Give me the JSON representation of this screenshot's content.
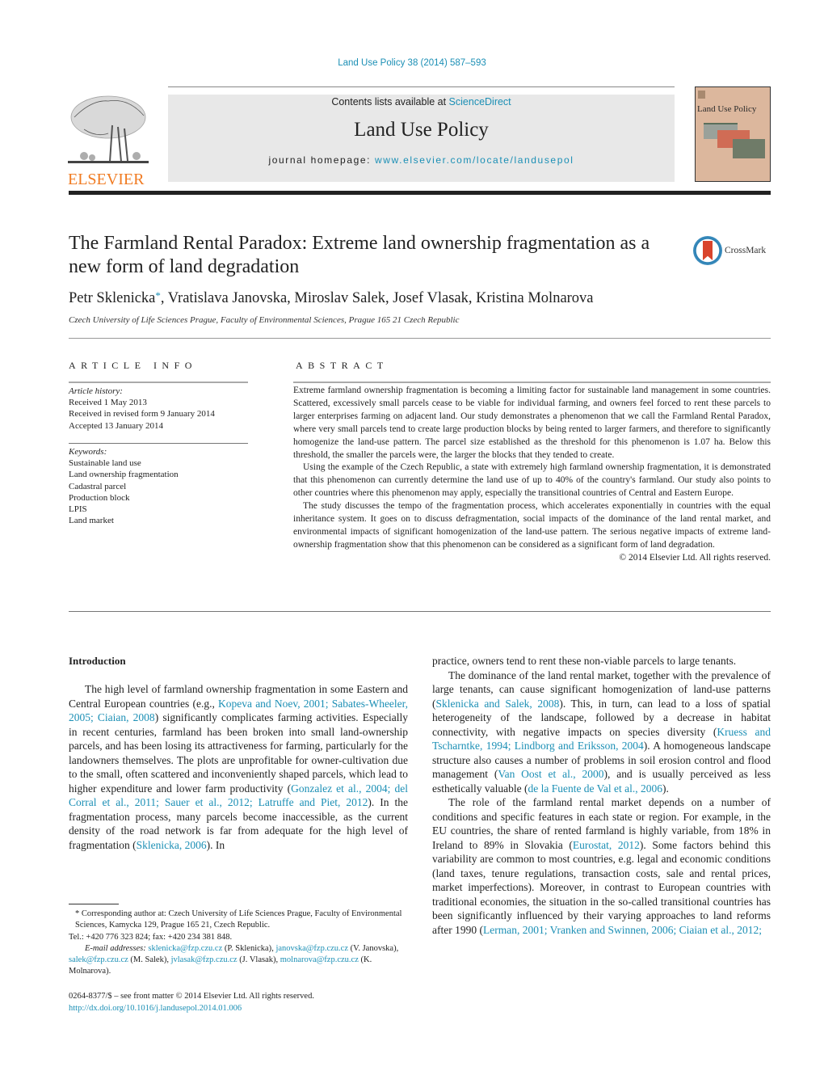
{
  "journal_ref": "Land Use Policy 38 (2014) 587–593",
  "publisher": {
    "name": "ELSEVIER",
    "brand_color": "#f07b22"
  },
  "masthead": {
    "contents_prefix": "Contents lists available at ",
    "contents_link": "ScienceDirect",
    "journal_title": "Land Use Policy",
    "homepage_prefix": "journal homepage: ",
    "homepage_link": "www.elsevier.com/locate/landusepol"
  },
  "cover": {
    "title": "Land Use Policy"
  },
  "crossmark": {
    "label": "CrossMark"
  },
  "article": {
    "title": "The Farmland Rental Paradox: Extreme land ownership fragmentation as a new form of land degradation",
    "first_author": "Petr Sklenicka",
    "corresponding_mark": "*",
    "other_authors": ", Vratislava Janovska, Miroslav Salek, Josef Vlasak, Kristina Molnarova",
    "affiliation": "Czech University of Life Sciences Prague, Faculty of Environmental Sciences, Prague 165 21 Czech Republic"
  },
  "article_info": {
    "heading": "ARTICLE INFO",
    "history_label": "Article history:",
    "history": [
      "Received 1 May 2013",
      "Received in revised form 9 January 2014",
      "Accepted 13 January 2014"
    ],
    "keywords_label": "Keywords:",
    "keywords": [
      "Sustainable land use",
      "Land ownership fragmentation",
      "Cadastral parcel",
      "Production block",
      "LPIS",
      "Land market"
    ]
  },
  "abstract": {
    "heading": "ABSTRACT",
    "paragraphs": [
      "Extreme farmland ownership fragmentation is becoming a limiting factor for sustainable land management in some countries. Scattered, excessively small parcels cease to be viable for individual farming, and owners feel forced to rent these parcels to larger enterprises farming on adjacent land. Our study demonstrates a phenomenon that we call the Farmland Rental Paradox, where very small parcels tend to create large production blocks by being rented to larger farmers, and therefore to significantly homogenize the land-use pattern. The parcel size established as the threshold for this phenomenon is 1.07 ha. Below this threshold, the smaller the parcels were, the larger the blocks that they tended to create.",
      "Using the example of the Czech Republic, a state with extremely high farmland ownership fragmentation, it is demonstrated that this phenomenon can currently determine the land use of up to 40% of the country's farmland. Our study also points to other countries where this phenomenon may apply, especially the transitional countries of Central and Eastern Europe.",
      "The study discusses the tempo of the fragmentation process, which accelerates exponentially in countries with the equal inheritance system. It goes on to discuss defragmentation, social impacts of the dominance of the land rental market, and environmental impacts of significant homogenization of the land-use pattern. The serious negative impacts of extreme land-ownership fragmentation show that this phenomenon can be considered as a significant form of land degradation."
    ],
    "copyright": "© 2014 Elsevier Ltd. All rights reserved."
  },
  "introduction": {
    "heading": "Introduction",
    "left_p1": [
      {
        "t": "The high level of farmland ownership fragmentation in some Eastern and Central European countries (e.g., "
      },
      {
        "t": "Kopeva and Noev, 2001; Sabates-Wheeler, 2005; Ciaian, 2008",
        "link": true
      },
      {
        "t": ") significantly complicates farming activities. Especially in recent centuries, farmland has been broken into small land-ownership parcels, and has been losing its attractiveness for farming, particularly for the landowners themselves. The plots are unprofitable for owner-cultivation due to the small, often scattered and inconveniently shaped parcels, which lead to higher expenditure and lower farm productivity ("
      },
      {
        "t": "Gonzalez et al., 2004; del Corral et al., 2011; Sauer et al., 2012; Latruffe and Piet, 2012",
        "link": true
      },
      {
        "t": "). In the fragmentation process, many parcels become inaccessible, as the current density of the road network is far from adequate for the high level of fragmentation ("
      },
      {
        "t": "Sklenicka, 2006",
        "link": true
      },
      {
        "t": "). In"
      }
    ],
    "right_p0": "practice, owners tend to rent these non-viable parcels to large tenants.",
    "right_p1": [
      {
        "t": "The dominance of the land rental market, together with the prevalence of large tenants, can cause significant homogenization of land-use patterns ("
      },
      {
        "t": "Sklenicka and Salek, 2008",
        "link": true
      },
      {
        "t": "). This, in turn, can lead to a loss of spatial heterogeneity of the landscape, followed by a decrease in habitat connectivity, with negative impacts on species diversity ("
      },
      {
        "t": "Kruess and Tscharntke, 1994; Lindborg and Eriksson, 2004",
        "link": true
      },
      {
        "t": "). A homogeneous landscape structure also causes a number of problems in soil erosion control and flood management ("
      },
      {
        "t": "Van Oost et al., 2000",
        "link": true
      },
      {
        "t": "), and is usually perceived as less esthetically valuable ("
      },
      {
        "t": "de la Fuente de Val et al., 2006",
        "link": true
      },
      {
        "t": ")."
      }
    ],
    "right_p2": [
      {
        "t": "The role of the farmland rental market depends on a number of conditions and specific features in each state or region. For example, in the EU countries, the share of rented farmland is highly variable, from 18% in Ireland to 89% in Slovakia ("
      },
      {
        "t": "Eurostat, 2012",
        "link": true
      },
      {
        "t": "). Some factors behind this variability are common to most countries, e.g. legal and economic conditions (land taxes, tenure regulations, transaction costs, sale and rental prices, market imperfections). Moreover, in contrast to European countries with traditional economies, the situation in the so-called transitional countries has been significantly influenced by their varying approaches to land reforms after 1990 ("
      },
      {
        "t": "Lerman, 2001; Vranken and Swinnen, 2006; Ciaian et al., 2012;",
        "link": true
      }
    ]
  },
  "footnotes": {
    "corresponding": "* Corresponding author at: Czech University of Life Sciences Prague, Faculty of Environmental Sciences, Kamycka 129, Prague 165 21, Czech Republic.",
    "tel": "Tel.: +420 776 323 824; fax: +420 234 381 848.",
    "email_label": "E-mail addresses:",
    "emails": [
      {
        "addr": "sklenicka@fzp.czu.cz",
        "who": "(P. Sklenicka)"
      },
      {
        "addr": "janovska@fzp.czu.cz",
        "who": "(V. Janovska)"
      },
      {
        "addr": "salek@fzp.czu.cz",
        "who": "(M. Salek)"
      },
      {
        "addr": "jvlasak@fzp.czu.cz",
        "who": "(J. Vlasak)"
      },
      {
        "addr": "molnarova@fzp.czu.cz",
        "who": "(K. Molnarova)."
      }
    ]
  },
  "front_matter": {
    "issn_line": "0264-8377/$ – see front matter © 2014 Elsevier Ltd. All rights reserved.",
    "doi": "http://dx.doi.org/10.1016/j.landusepol.2014.01.006"
  }
}
